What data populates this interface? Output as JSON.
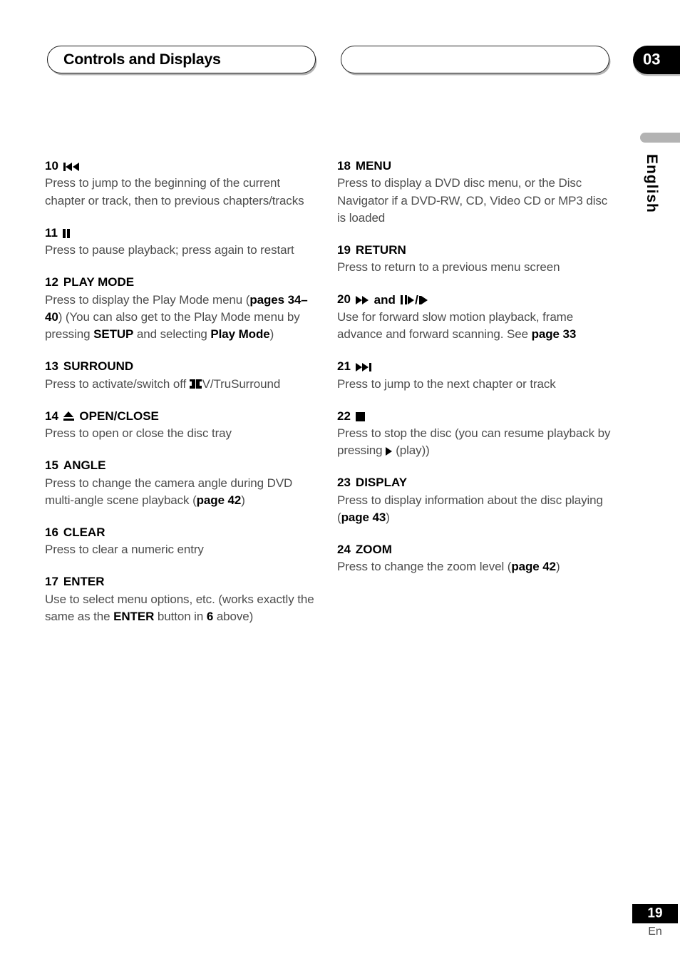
{
  "header": {
    "section_title": "Controls and Displays",
    "secondary_pill_text": "",
    "chapter_number": "03"
  },
  "margin": {
    "language_label": "English"
  },
  "footer": {
    "page_number": "19",
    "language_code": "En"
  },
  "colors": {
    "heading": "#000000",
    "body_text": "#4d4d4d",
    "badge_background": "#000000",
    "badge_text": "#ffffff",
    "tab_gray": "#b3b3b3",
    "pill_shadow": "#b4b4b4"
  },
  "left_column": [
    {
      "number": "10",
      "icon_name": "previous-track-icon",
      "title": "",
      "body_segments": [
        {
          "text": "Press to jump to the beginning of the current chapter or track, then to previous chapters/tracks",
          "bold": false
        }
      ]
    },
    {
      "number": "11",
      "icon_name": "pause-icon",
      "title": "",
      "body_segments": [
        {
          "text": "Press to pause playback; press again to restart",
          "bold": false
        }
      ]
    },
    {
      "number": "12",
      "icon_name": "",
      "title": "PLAY MODE",
      "body_segments": [
        {
          "text": "Press to display the Play Mode menu (",
          "bold": false
        },
        {
          "text": "pages 34–40",
          "bold": true
        },
        {
          "text": ") (You can also get to the Play Mode menu by pressing ",
          "bold": false
        },
        {
          "text": "SETUP",
          "bold": true
        },
        {
          "text": " and selecting ",
          "bold": false
        },
        {
          "text": "Play Mode",
          "bold": true
        },
        {
          "text": ")",
          "bold": false
        }
      ]
    },
    {
      "number": "13",
      "icon_name": "",
      "title": "SURROUND",
      "body_segments": [
        {
          "text": "Press to activate/switch off ",
          "bold": false
        },
        {
          "icon": "dolby-digital-logo"
        },
        {
          "text": "V/TruSurround",
          "bold": false
        }
      ]
    },
    {
      "number": "14",
      "icon_name": "eject-icon",
      "title": "OPEN/CLOSE",
      "body_segments": [
        {
          "text": "Press to open or close the disc tray",
          "bold": false
        }
      ]
    },
    {
      "number": "15",
      "icon_name": "",
      "title": "ANGLE",
      "body_segments": [
        {
          "text": "Press to change the camera angle during DVD multi-angle scene playback (",
          "bold": false
        },
        {
          "text": "page 42",
          "bold": true
        },
        {
          "text": ")",
          "bold": false
        }
      ]
    },
    {
      "number": "16",
      "icon_name": "",
      "title": "CLEAR",
      "body_segments": [
        {
          "text": "Press to clear a numeric entry",
          "bold": false
        }
      ]
    },
    {
      "number": "17",
      "icon_name": "",
      "title": "ENTER",
      "body_segments": [
        {
          "text": "Use to select menu options, etc. (works exactly the same as the ",
          "bold": false
        },
        {
          "text": "ENTER",
          "bold": true
        },
        {
          "text": " button in ",
          "bold": false
        },
        {
          "text": "6",
          "bold": true
        },
        {
          "text": " above)",
          "bold": false
        }
      ]
    }
  ],
  "right_column": [
    {
      "number": "18",
      "icon_name": "",
      "title": "MENU",
      "body_segments": [
        {
          "text": "Press to display a DVD disc menu, or the Disc Navigator if a DVD-RW, CD, Video CD or MP3 disc is loaded",
          "bold": false
        }
      ]
    },
    {
      "number": "19",
      "icon_name": "",
      "title": "RETURN",
      "body_segments": [
        {
          "text": "Press to return to a previous menu screen",
          "bold": false
        }
      ]
    },
    {
      "number": "20",
      "icon_name": "fast-forward-and-slow-motion-icons",
      "title": "",
      "body_segments": [
        {
          "text": "Use for forward slow motion playback, frame advance and forward scanning. See ",
          "bold": false
        },
        {
          "text": "page 33",
          "bold": true
        }
      ]
    },
    {
      "number": "21",
      "icon_name": "next-track-icon",
      "title": "",
      "body_segments": [
        {
          "text": "Press to jump to the next chapter or track",
          "bold": false
        }
      ]
    },
    {
      "number": "22",
      "icon_name": "stop-icon",
      "title": "",
      "body_segments": [
        {
          "text": "Press to stop the disc (you can resume playback by pressing ",
          "bold": false
        },
        {
          "icon": "play-icon"
        },
        {
          "text": " (play))",
          "bold": false
        }
      ]
    },
    {
      "number": "23",
      "icon_name": "",
      "title": "DISPLAY",
      "body_segments": [
        {
          "text": "Press to display information about the disc playing (",
          "bold": false
        },
        {
          "text": "page 43",
          "bold": true
        },
        {
          "text": ")",
          "bold": false
        }
      ]
    },
    {
      "number": "24",
      "icon_name": "",
      "title": "ZOOM",
      "body_segments": [
        {
          "text": "Press to change the zoom level (",
          "bold": false
        },
        {
          "text": "page 42",
          "bold": true
        },
        {
          "text": ")",
          "bold": false
        }
      ]
    }
  ]
}
